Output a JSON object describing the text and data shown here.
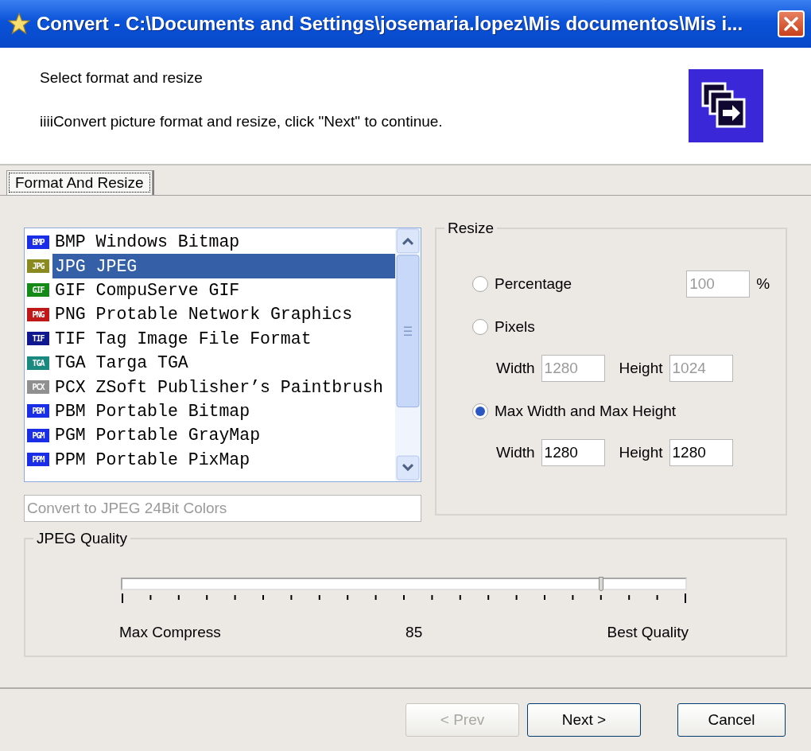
{
  "window": {
    "title": "Convert - C:\\Documents and Settings\\josemaria.lopez\\Mis documentos\\Mis i..."
  },
  "header": {
    "title": "Select format and resize",
    "description": "iiiiConvert picture format and resize, click \"Next\" to continue."
  },
  "tabs": [
    {
      "label": "Format And Resize",
      "selected": true
    }
  ],
  "formats": [
    {
      "badge": "BMP",
      "label": "BMP Windows Bitmap",
      "color": "#1a2ee8",
      "selected": false
    },
    {
      "badge": "JPG",
      "label": "JPG JPEG",
      "color": "#8a8a20",
      "selected": true
    },
    {
      "badge": "GIF",
      "label": "GIF CompuServe GIF",
      "color": "#168a16",
      "selected": false
    },
    {
      "badge": "PNG",
      "label": "PNG Protable Network Graphics",
      "color": "#c01818",
      "selected": false
    },
    {
      "badge": "TIF",
      "label": "TIF Tag Image File Format",
      "color": "#101890",
      "selected": false
    },
    {
      "badge": "TGA",
      "label": "TGA Targa TGA",
      "color": "#1a8a80",
      "selected": false
    },
    {
      "badge": "PCX",
      "label": "PCX ZSoft Publisher’s Paintbrush",
      "color": "#909090",
      "selected": false
    },
    {
      "badge": "PBM",
      "label": "PBM Portable Bitmap",
      "color": "#1a2ee8",
      "selected": false
    },
    {
      "badge": "PGM",
      "label": "PGM Portable GrayMap",
      "color": "#1a2ee8",
      "selected": false
    },
    {
      "badge": "PPM",
      "label": "PPM Portable PixMap",
      "color": "#1a2ee8",
      "selected": false
    }
  ],
  "format_description": {
    "value": "Convert to JPEG 24Bit Colors",
    "disabled": true
  },
  "resize": {
    "title": "Resize",
    "options": [
      {
        "kind": "percent",
        "label": "Percentage",
        "selected": false,
        "field": {
          "value": "100",
          "disabled": true
        },
        "unit": "%"
      },
      {
        "kind": "dimensions",
        "label": "Pixels",
        "selected": false,
        "fields": [
          {
            "label": "Width",
            "value": "1280",
            "disabled": true
          },
          {
            "label": "Height",
            "value": "1024",
            "disabled": true
          }
        ]
      },
      {
        "kind": "dimensions",
        "label": "Max Width and Max Height",
        "selected": true,
        "fields": [
          {
            "label": "Width",
            "value": "1280",
            "disabled": false
          },
          {
            "label": "Height",
            "value": "1280",
            "disabled": false
          }
        ]
      }
    ]
  },
  "quality": {
    "title": "JPEG Quality",
    "level": 0.85,
    "min_label": "Max Compress",
    "value": "85",
    "max_label": "Best Quality"
  },
  "buttons": [
    {
      "label": "< Prev",
      "disabled": true
    },
    {
      "label": "Next >",
      "disabled": false
    },
    {
      "label": "Cancel",
      "disabled": false
    }
  ]
}
